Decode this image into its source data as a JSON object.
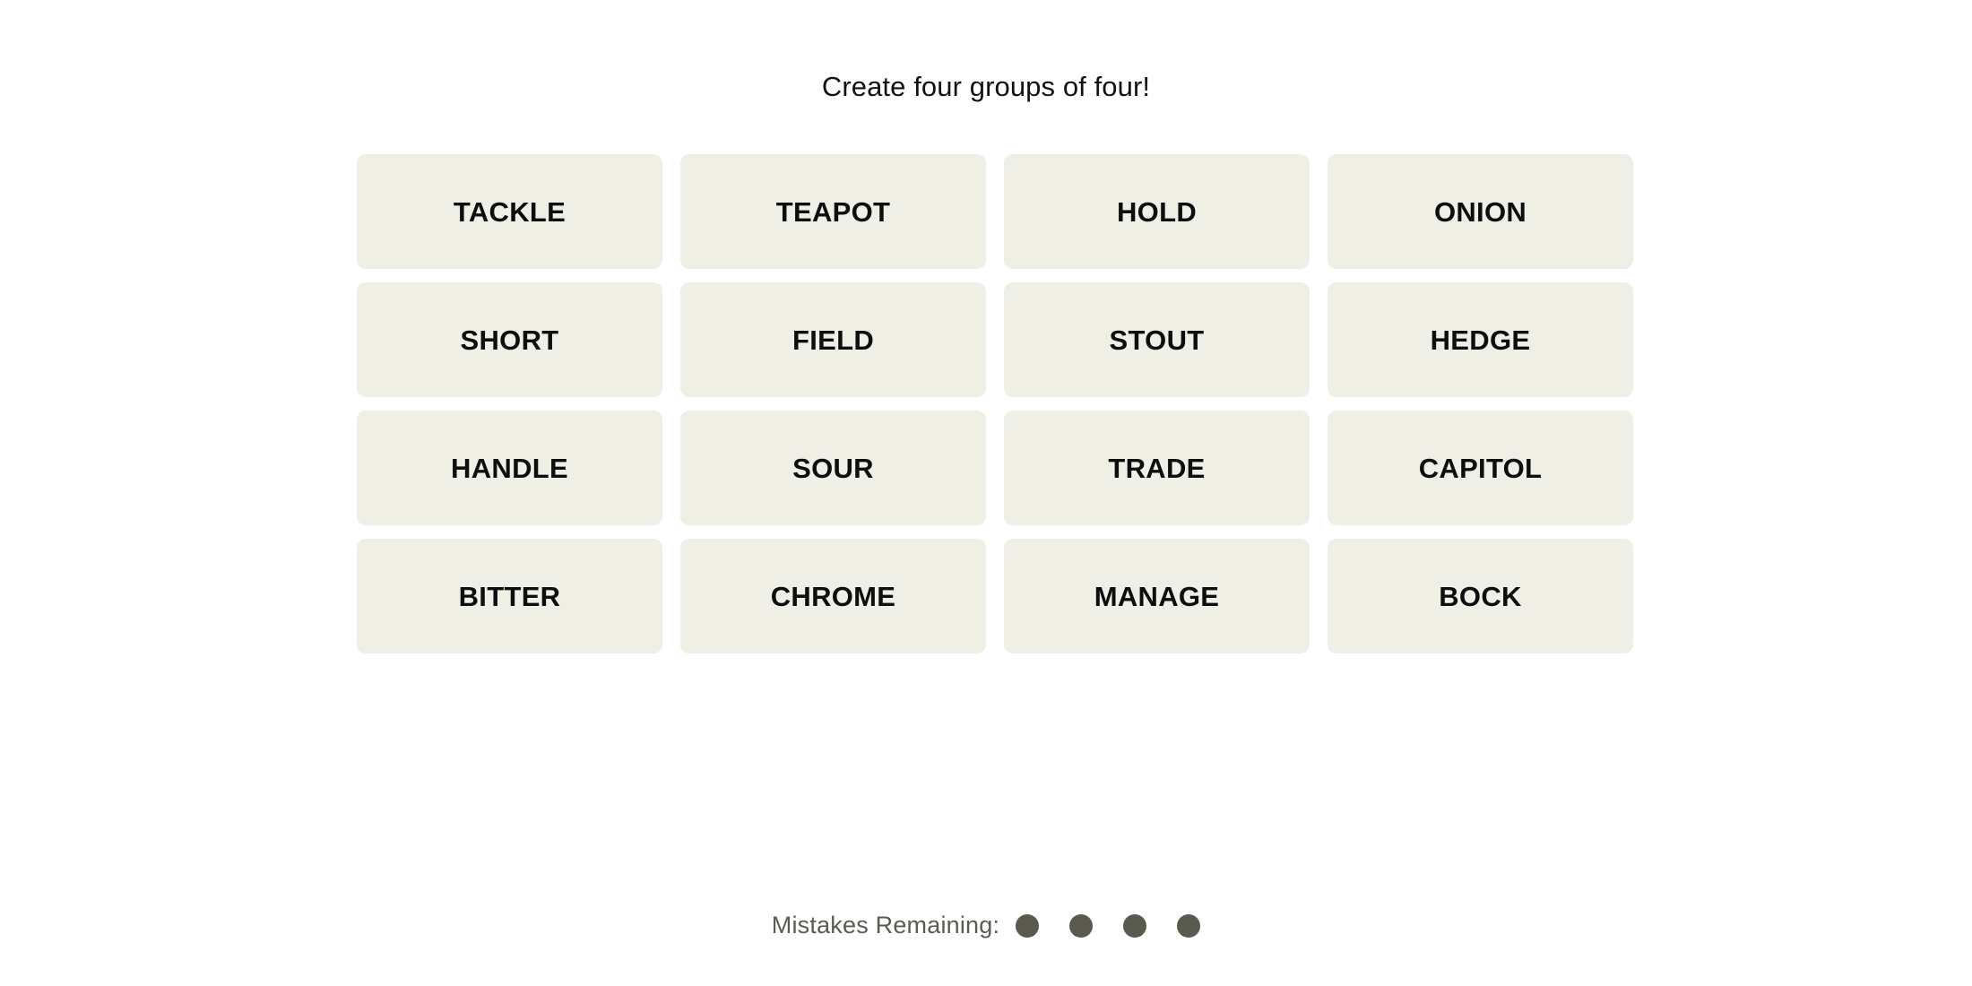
{
  "header": {
    "instruction": "Create four groups of four!"
  },
  "board": {
    "rows": 4,
    "columns": 4,
    "tiles": [
      {
        "label": "TACKLE",
        "row": 1,
        "col": 1
      },
      {
        "label": "TEAPOT",
        "row": 1,
        "col": 2
      },
      {
        "label": "HOLD",
        "row": 1,
        "col": 3
      },
      {
        "label": "ONION",
        "row": 1,
        "col": 4
      },
      {
        "label": "SHORT",
        "row": 2,
        "col": 1
      },
      {
        "label": "FIELD",
        "row": 2,
        "col": 2
      },
      {
        "label": "STOUT",
        "row": 2,
        "col": 3
      },
      {
        "label": "HEDGE",
        "row": 2,
        "col": 4
      },
      {
        "label": "HANDLE",
        "row": 3,
        "col": 1
      },
      {
        "label": "SOUR",
        "row": 3,
        "col": 2
      },
      {
        "label": "TRADE",
        "row": 3,
        "col": 3
      },
      {
        "label": "CAPITOL",
        "row": 3,
        "col": 4
      },
      {
        "label": "BITTER",
        "row": 4,
        "col": 1
      },
      {
        "label": "CHROME",
        "row": 4,
        "col": 2
      },
      {
        "label": "MANAGE",
        "row": 4,
        "col": 3
      },
      {
        "label": "BOCK",
        "row": 4,
        "col": 4
      }
    ]
  },
  "footer": {
    "mistakes_label": "Mistakes Remaining:",
    "mistakes_remaining": 4,
    "dots": [
      {
        "state": "remaining"
      },
      {
        "state": "remaining"
      },
      {
        "state": "remaining"
      },
      {
        "state": "remaining"
      }
    ]
  },
  "colors": {
    "page_background": "#FFFFFF",
    "tile_background": "#EFEFE6",
    "tile_text": "#0E0E0E",
    "title_text": "#121212",
    "mistakes_label_text": "#5B5B53",
    "mistake_dot": "#5A594E"
  }
}
